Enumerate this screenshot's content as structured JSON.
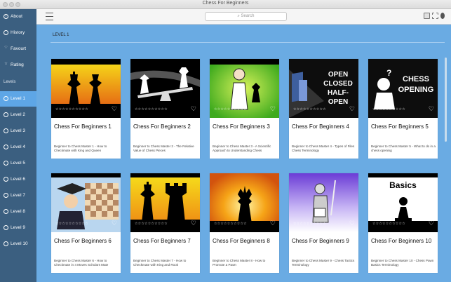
{
  "window": {
    "title": "Chess For Beginners"
  },
  "toolbar": {
    "search_placeholder": "Search"
  },
  "sidebar": {
    "items": [
      {
        "label": "About",
        "icon": "info-icon"
      },
      {
        "label": "History",
        "icon": "history-icon"
      },
      {
        "label": "Favourt",
        "icon": "heart-icon"
      },
      {
        "label": "Rating",
        "icon": "star-icon"
      }
    ],
    "section_label": "Levels",
    "levels": [
      {
        "label": "Level 1",
        "active": true
      },
      {
        "label": "Level 2"
      },
      {
        "label": "Level 3"
      },
      {
        "label": "Level 4"
      },
      {
        "label": "Level 5"
      },
      {
        "label": "Level 6"
      },
      {
        "label": "Level 7"
      },
      {
        "label": "Level 8"
      },
      {
        "label": "Level 9"
      },
      {
        "label": "Level 10"
      }
    ]
  },
  "main": {
    "level_title": "LEVEL 1",
    "cards": [
      {
        "title": "Chess For Beginners 1",
        "desc": "Beginner to Chess Master 1 - How to Checkmate with King and Queen",
        "art_text": ""
      },
      {
        "title": "Chess For Beginners 2",
        "desc": "Beginner to Chess Master 2 - The Relative Value of Chess Pieces",
        "art_text": ""
      },
      {
        "title": "Chess For Beginners 3",
        "desc": "Beginner to Chess Master 3 - A Scientific Approach to Understanding Chess",
        "art_text": ""
      },
      {
        "title": "Chess For Beginners 4",
        "desc": "Beginner to Chess Master 4 - Types of Files Chess Terminology",
        "art_text": "OPEN CLOSED HALF-OPEN"
      },
      {
        "title": "Chess For Beginners 5",
        "desc": "Beginner to Chess Master 5 - What to do in a chess opening",
        "art_text": "CHESS OPENING"
      },
      {
        "title": "Chess For Beginners 6",
        "desc": "Beginner to Chess Master 6 - How to Checkmate in 4 Moves Scholars Mate",
        "art_text": ""
      },
      {
        "title": "Chess For Beginners 7",
        "desc": "Beginner to Chess Master 7 - How to Checkmate with King and Rook",
        "art_text": ""
      },
      {
        "title": "Chess For Beginners 8",
        "desc": "Beginner to Chess Master 8 - How to Promote a Pawn",
        "art_text": ""
      },
      {
        "title": "Chess For Beginners 9",
        "desc": "Beginner to Chess Master 9 - Chess Tactics Terminology",
        "art_text": ""
      },
      {
        "title": "Chess For Beginners 10",
        "desc": "Beginner to Chess Master 10 - Chess Pawn Basics Terminology",
        "art_text": "Basics"
      }
    ],
    "rating_stars": "☆☆☆☆☆☆☆☆☆☆"
  }
}
